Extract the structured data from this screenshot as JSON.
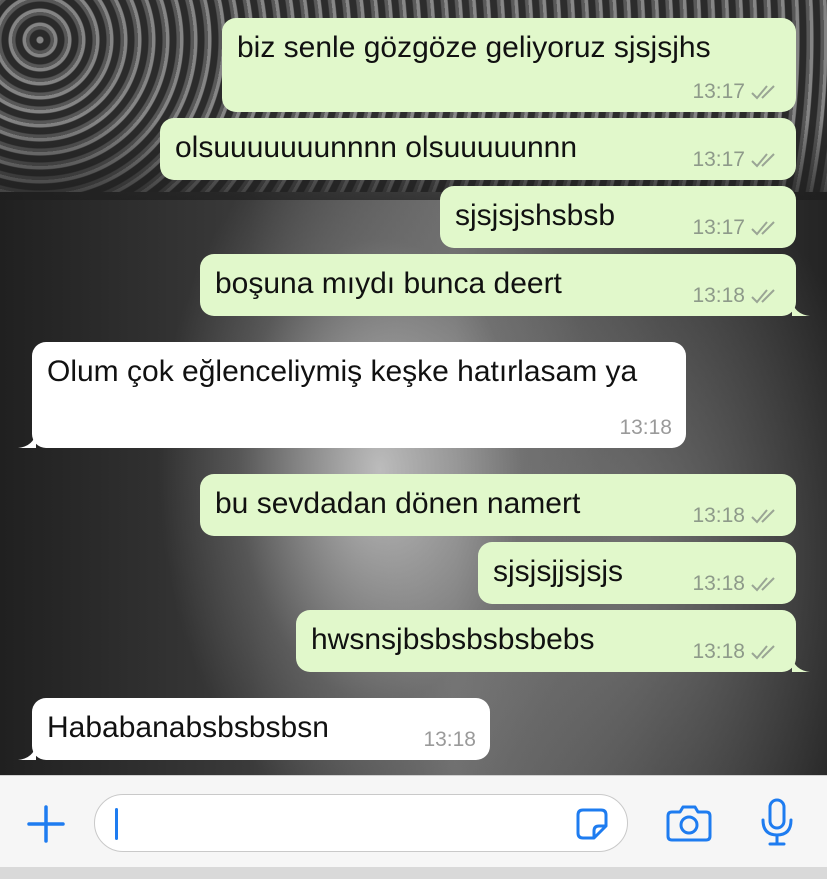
{
  "messages": [
    {
      "direction": "out",
      "text": "biz senle gözgöze geliyoruz sjsjsjhs",
      "time": "13:17",
      "status": "read"
    },
    {
      "direction": "out",
      "text": "olsuuuuuuunnnn olsuuuuunnn",
      "time": "13:17",
      "status": "read"
    },
    {
      "direction": "out",
      "text": "sjsjsjshsbsb",
      "time": "13:17",
      "status": "read"
    },
    {
      "direction": "out",
      "text": "boşuna mıydı bunca deert",
      "time": "13:18",
      "status": "read"
    },
    {
      "direction": "in",
      "text": "Olum çok eğlenceliymiş keşke hatırlasam ya",
      "time": "13:18"
    },
    {
      "direction": "out",
      "text": "bu sevdadan dönen namert",
      "time": "13:18",
      "status": "read"
    },
    {
      "direction": "out",
      "text": "sjsjsjjsjsjs",
      "time": "13:18",
      "status": "read"
    },
    {
      "direction": "out",
      "text": "hwsnsjbsbsbsbsbebs",
      "time": "13:18",
      "status": "read"
    },
    {
      "direction": "in",
      "text": "Hababanabsbsbsbsn",
      "time": "13:18"
    }
  ],
  "composer": {
    "attach_icon": "plus-icon",
    "input_value": "",
    "sticker_icon": "sticker-icon",
    "camera_icon": "camera-icon",
    "mic_icon": "microphone-icon"
  },
  "colors": {
    "outgoing_bubble": "#e1f8cb",
    "incoming_bubble": "#ffffff",
    "accent": "#1e7cf0",
    "timestamp": "#8e9a8a"
  }
}
